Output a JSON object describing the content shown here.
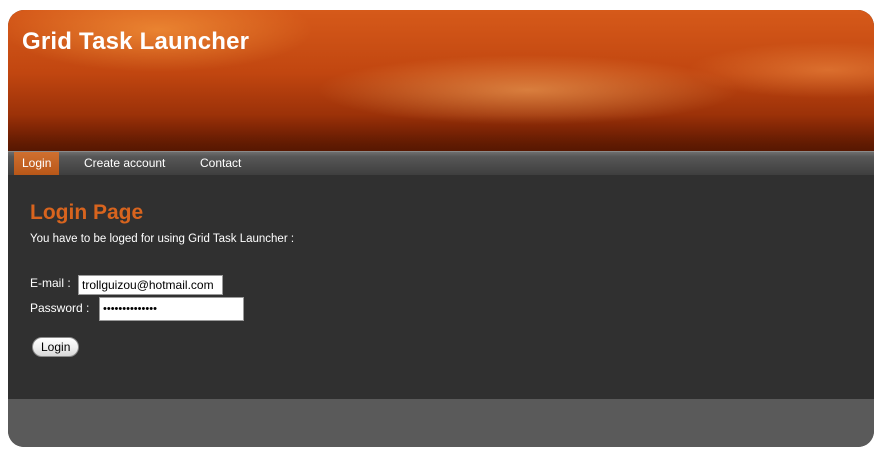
{
  "header": {
    "app_title": "Grid Task Launcher"
  },
  "nav": {
    "items": [
      {
        "label": "Login",
        "active": true
      },
      {
        "label": "Create account",
        "active": false
      },
      {
        "label": "Contact",
        "active": false
      }
    ]
  },
  "main": {
    "heading": "Login Page",
    "intro": "You have to be loged for using Grid Task Launcher :",
    "email": {
      "label": "E-mail :",
      "value": "trollguizou@hotmail.com"
    },
    "password": {
      "label": "Password :",
      "value": "••••••••••••••"
    },
    "login_button": "Login"
  },
  "colors": {
    "accent": "#d8641e",
    "header": "#c14610",
    "background": "#303030",
    "footer": "#5a5a5a"
  }
}
